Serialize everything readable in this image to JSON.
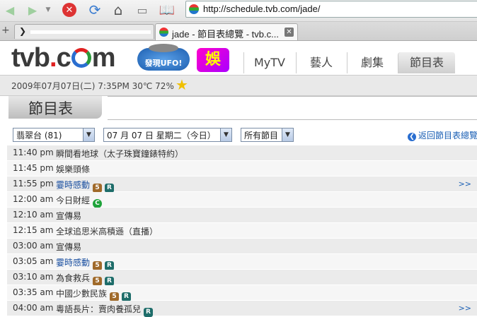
{
  "browser": {
    "url": "http://schedule.tvb.com/jade/",
    "tab_title": "jade - 節目表總覽 - tvb.c..."
  },
  "site": {
    "logo_text": "tvb",
    "logo_suffix": "m",
    "ufo_label": "發現UFO!",
    "ent_label": "娛",
    "nav": [
      "MyTV",
      "藝人",
      "劇集",
      "節目表"
    ]
  },
  "datebar": {
    "text": "2009年07月07日(二)  7:35PM   30℃ 72%"
  },
  "section": {
    "title": "節目表"
  },
  "filters": {
    "channel": "翡翠台 (81)",
    "date": "07 月  07 日  星期二（今日）",
    "category": "所有節目",
    "back_link": "返回節目表總覽"
  },
  "schedule": [
    {
      "time": "11:40 pm",
      "title": "瞬間看地球（太子珠寶鐘錶特約）",
      "link": false,
      "badges": [],
      "more": ""
    },
    {
      "time": "11:45 pm",
      "title": "娛樂頭條",
      "link": false,
      "badges": [],
      "more": ""
    },
    {
      "time": "11:55 pm",
      "title": "霎時感動",
      "link": true,
      "badges": [
        "5",
        "R"
      ],
      "more": ">>"
    },
    {
      "time": "12:00 am",
      "title": "今日財經",
      "link": false,
      "badges": [
        "C"
      ],
      "more": ""
    },
    {
      "time": "12:10 am",
      "title": "宣傳易",
      "link": false,
      "badges": [],
      "more": ""
    },
    {
      "time": "12:15 am",
      "title": "全球追思米高積遜（直播）",
      "link": false,
      "badges": [],
      "more": ""
    },
    {
      "time": "03:00 am",
      "title": "宣傳易",
      "link": false,
      "badges": [],
      "more": ""
    },
    {
      "time": "03:05 am",
      "title": "霎時感動",
      "link": true,
      "badges": [
        "5",
        "R"
      ],
      "more": ""
    },
    {
      "time": "03:10 am",
      "title": "為食救兵",
      "link": false,
      "badges": [
        "5",
        "R"
      ],
      "more": ""
    },
    {
      "time": "03:35 am",
      "title": "中國少數民族",
      "link": false,
      "badges": [
        "5",
        "R"
      ],
      "more": ""
    },
    {
      "time": "04:00 am",
      "title": "粵語長片：賣肉養孤兒",
      "link": false,
      "badges": [
        "R"
      ],
      "more": ">>"
    }
  ]
}
